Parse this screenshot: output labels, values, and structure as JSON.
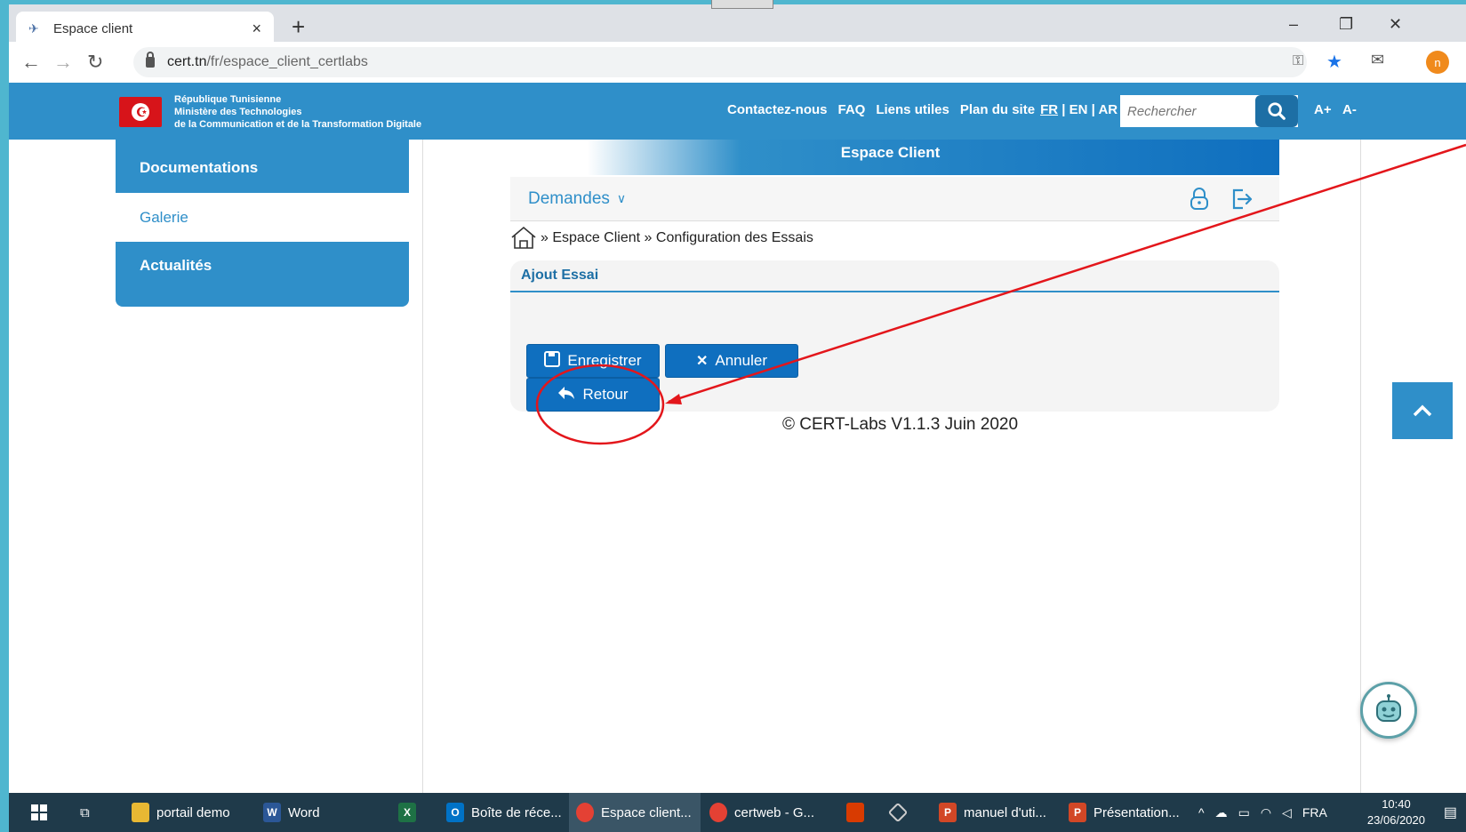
{
  "browser": {
    "tab_title": "Espace client",
    "tab_close": "×",
    "new_tab": "+",
    "url_host": "cert.tn",
    "url_path": "/fr/espace_client_certlabs",
    "profile_initial": "n",
    "window_controls": [
      "–",
      "❐",
      "✕"
    ]
  },
  "header": {
    "ministry_lines": [
      "République Tunisienne",
      "Ministère des Technologies",
      "de la Communication et de la Transformation Digitale"
    ],
    "nav": [
      "Contactez-nous",
      "FAQ",
      "Liens utiles",
      "Plan du site"
    ],
    "languages": [
      "FR",
      "EN",
      "AR"
    ],
    "search_placeholder": "Rechercher",
    "font_increase": "A+",
    "font_decrease": "A-",
    "brand_color": "#2f8fc9"
  },
  "sidebar": {
    "items": [
      {
        "label": "Documentations",
        "active": false
      },
      {
        "label": "Galerie",
        "active": true
      },
      {
        "label": "Actualités",
        "active": false
      }
    ]
  },
  "main": {
    "banner_title": "Espace Client",
    "menu_label": "Demandes",
    "breadcrumb": {
      "sep": "»",
      "items": [
        "Espace Client",
        "Configuration des Essais"
      ]
    },
    "panel_title": "Ajout Essai",
    "buttons": {
      "save": "Enregistrer",
      "cancel": "Annuler",
      "back": "Retour"
    },
    "copyright": "© CERT-Labs V1.1.3 Juin 2020"
  },
  "taskbar": {
    "items": [
      "portail demo",
      "Word",
      "Boîte de réce...",
      "Espace client...",
      "certweb - G...",
      "manuel d'uti...",
      "Présentation..."
    ],
    "language": "FRA",
    "time": "10:40",
    "date": "23/06/2020"
  },
  "annotation_color": "#e3161b"
}
